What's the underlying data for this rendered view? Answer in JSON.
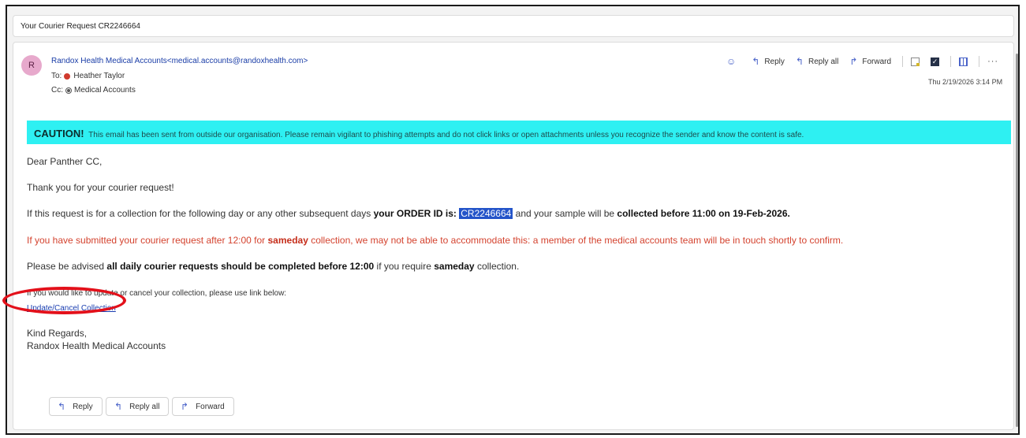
{
  "subject": "Your Courier Request CR2246664",
  "header": {
    "avatar_initial": "R",
    "sender": "Randox Health Medical Accounts<medical.accounts@randoxhealth.com>",
    "to_label": "To:",
    "to_name": "Heather Taylor",
    "cc_label": "Cc:",
    "cc_name": "Medical Accounts",
    "date": "Thu 2/19/2026 3:14 PM"
  },
  "toolbar": {
    "reply": "Reply",
    "reply_all": "Reply all",
    "forward": "Forward",
    "more": "···"
  },
  "caution": {
    "label": "CAUTION!",
    "message": "This email has been sent from outside our organisation. Please remain vigilant to phishing attempts and do not click links or open attachments unless you recognize the sender and know the content is safe."
  },
  "body": {
    "greeting": "Dear Panther CC,",
    "thanks": "Thank you for your courier request!",
    "order_pre": "If this request is for a collection for the following day or any other subsequent days ",
    "order_bold": "your ORDER ID is: ",
    "order_id": "CR2246664",
    "order_mid": " and your sample will be ",
    "order_bold2": "collected before 11:00 on 19-Feb-2026.",
    "warn_pre": "If you have submitted your courier request after 12:00 for ",
    "warn_bold": "sameday",
    "warn_post": " collection, we may not be able to accommodate this: a member of the medical accounts team will be in touch shortly to confirm.",
    "advise_pre": "Please be advised ",
    "advise_bold": "all daily courier requests should be completed before 12:00",
    "advise_mid": " if you require ",
    "advise_bold2": "sameday",
    "advise_post": " collection.",
    "update_text": "If you would like to update or cancel your collection, please use link below:",
    "update_link": "Update/Cancel Collection",
    "regards": "Kind Regards,",
    "signature": "Randox Health Medical Accounts"
  },
  "footer_buttons": {
    "reply": "Reply",
    "reply_all": "Reply all",
    "forward": "Forward"
  },
  "colors": {
    "caution_bg": "#2ef0f2",
    "annotation": "#e3101a",
    "selection": "#2454c9",
    "warning_text": "#d4432f"
  }
}
